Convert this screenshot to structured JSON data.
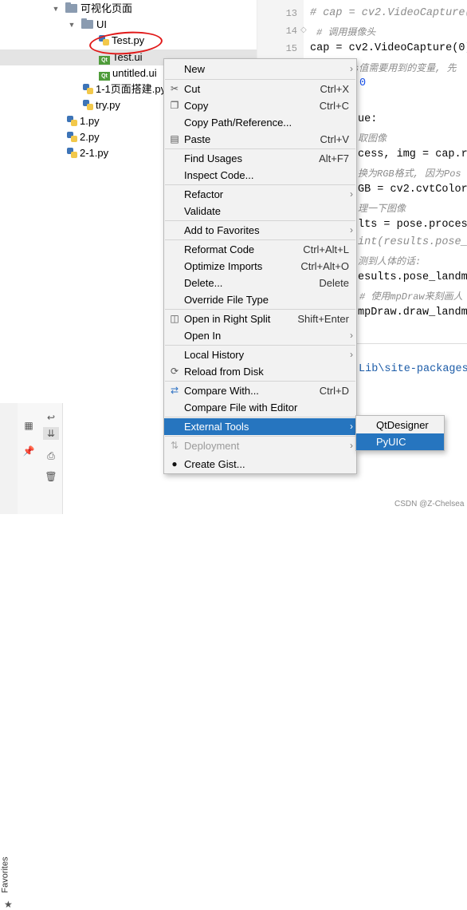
{
  "tree": {
    "items": [
      {
        "label": "可视化页面"
      },
      {
        "label": "UI"
      },
      {
        "label": "Test.py"
      },
      {
        "label": "Test.ui"
      },
      {
        "label": "untitled.ui"
      },
      {
        "label": "1-1页面搭建.py"
      },
      {
        "label": "try.py"
      },
      {
        "label": "1.py"
      },
      {
        "label": "2.py"
      },
      {
        "label": "2-1.py"
      }
    ],
    "qt_badge": "Qt"
  },
  "editor": {
    "line_numbers": [
      "13",
      "14",
      "15"
    ],
    "lines": [
      "# cap = cv2.VideoCapture(",
      "# 调用摄像头",
      "cap = cv2.VideoCapture(0)",
      "s值需要用到的变量, 先",
      "0",
      "ue:",
      "取图像",
      "cess, img = cap.re",
      "换为RGB格式, 因为Pos",
      "GB = cv2.cvtColor",
      "理一下图像",
      "lts = pose.proces",
      "int(results.pose_",
      "测到人体的话:",
      "esults.pose_landm",
      "# 使用mpDraw来刻画人",
      "mpDraw.draw_landm"
    ],
    "path_fragment": "Lib\\site-packages"
  },
  "context_menu": {
    "items": [
      {
        "label": "New",
        "shortcut": "",
        "submenu": true
      },
      {
        "label": "Cut",
        "shortcut": "Ctrl+X",
        "icon": "scissors-icon"
      },
      {
        "label": "Copy",
        "shortcut": "Ctrl+C",
        "icon": "copy-icon"
      },
      {
        "label": "Copy Path/Reference...",
        "shortcut": ""
      },
      {
        "label": "Paste",
        "shortcut": "Ctrl+V",
        "icon": "paste-icon"
      },
      {
        "label": "Find Usages",
        "shortcut": "Alt+F7"
      },
      {
        "label": "Inspect Code...",
        "shortcut": ""
      },
      {
        "label": "Refactor",
        "shortcut": "",
        "submenu": true
      },
      {
        "label": "Validate",
        "shortcut": ""
      },
      {
        "label": "Add to Favorites",
        "shortcut": "",
        "submenu": true
      },
      {
        "label": "Reformat Code",
        "shortcut": "Ctrl+Alt+L"
      },
      {
        "label": "Optimize Imports",
        "shortcut": "Ctrl+Alt+O"
      },
      {
        "label": "Delete...",
        "shortcut": "Delete"
      },
      {
        "label": "Override File Type",
        "shortcut": ""
      },
      {
        "label": "Open in Right Split",
        "shortcut": "Shift+Enter",
        "icon": "split-icon"
      },
      {
        "label": "Open In",
        "shortcut": "",
        "submenu": true
      },
      {
        "label": "Local History",
        "shortcut": "",
        "submenu": true
      },
      {
        "label": "Reload from Disk",
        "shortcut": "",
        "icon": "reload-icon"
      },
      {
        "label": "Compare With...",
        "shortcut": "Ctrl+D",
        "icon": "compare-icon"
      },
      {
        "label": "Compare File with Editor",
        "shortcut": ""
      },
      {
        "label": "External Tools",
        "shortcut": "",
        "submenu": true,
        "active": true
      },
      {
        "label": "Deployment",
        "shortcut": "",
        "submenu": true,
        "disabled": true,
        "icon": "deployment-icon"
      },
      {
        "label": "Create Gist...",
        "shortcut": "",
        "icon": "github-icon"
      }
    ]
  },
  "submenu": {
    "items": [
      {
        "label": "QtDesigner"
      },
      {
        "label": "PyUIC",
        "active": true
      }
    ]
  },
  "sidebar": {
    "favorites_label": "Favorites"
  },
  "watermark": "CSDN @Z-Chelsea",
  "colors": {
    "selection": "#2675bf",
    "annotation": "#e11a1a",
    "menu_bg": "#f2f2f2"
  }
}
